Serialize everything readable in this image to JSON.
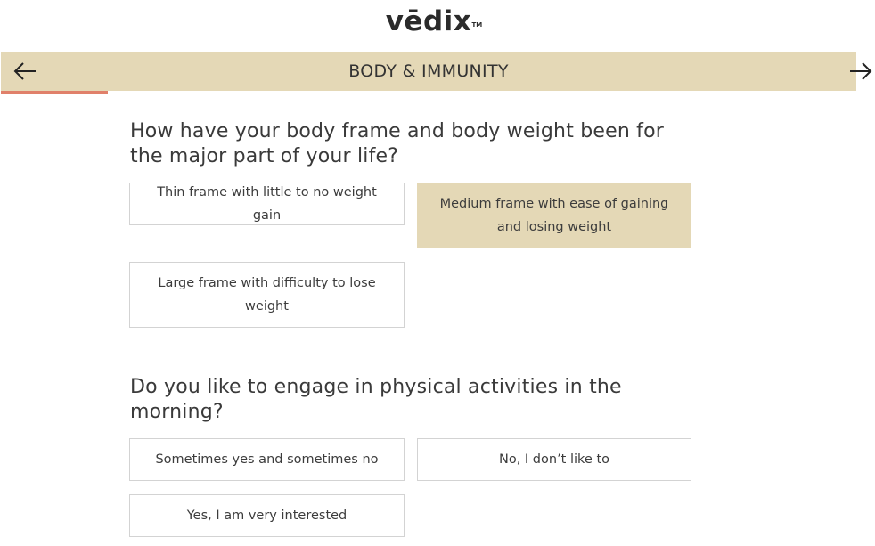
{
  "brand": {
    "name": "vēdix",
    "trademark": "TM"
  },
  "header": {
    "section_title": "BODY & IMMUNITY",
    "back_icon": "arrow-left-icon",
    "next_icon": "arrow-right-icon",
    "progress_fraction": 0.125,
    "colors": {
      "bar": "#e4d8b6",
      "progress": "#e0806a"
    }
  },
  "questions": [
    {
      "text": "How have your body frame and body weight been for the major part of your life?",
      "options": [
        {
          "label": "Thin frame with little to no weight gain",
          "selected": false
        },
        {
          "label": "Medium frame with ease of gaining and losing weight",
          "selected": true
        },
        {
          "label": "Large frame with difficulty to lose weight",
          "selected": false
        }
      ]
    },
    {
      "text": "Do you like to engage in physical activities in the morning?",
      "options": [
        {
          "label": "Sometimes yes and sometimes no",
          "selected": false
        },
        {
          "label": "No, I don’t like to",
          "selected": false
        },
        {
          "label": "Yes, I am very interested",
          "selected": false
        }
      ]
    }
  ]
}
